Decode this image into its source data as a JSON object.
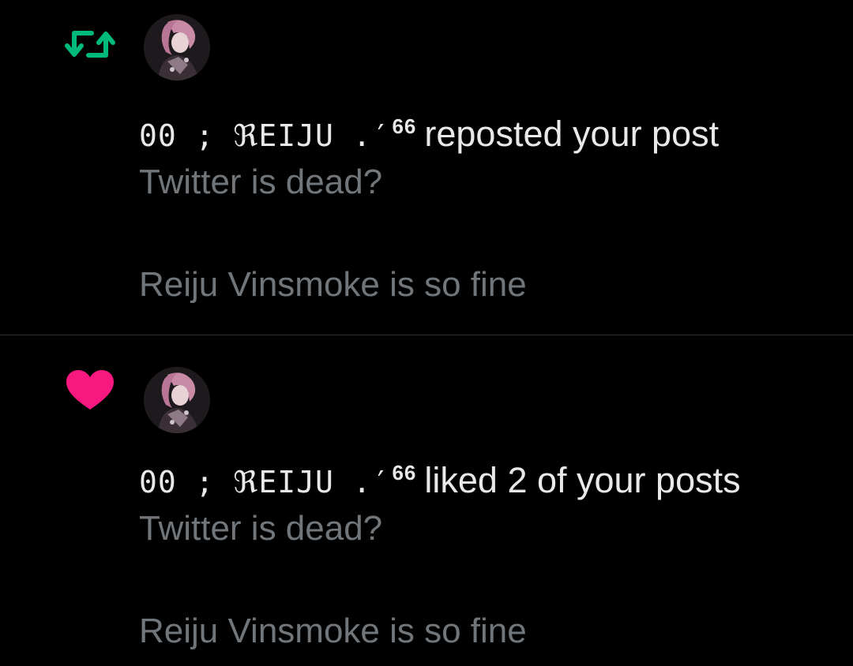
{
  "notifications": [
    {
      "type_icon": "repost-icon",
      "user_handle": "00 ; ℜEIJU .′",
      "handle_superscript": "66",
      "action": "reposted your post",
      "post_lines": [
        "Twitter is dead?",
        "Reiju Vinsmoke is so fine"
      ]
    },
    {
      "type_icon": "heart-icon",
      "user_handle": "00 ; ℜEIJU .′",
      "handle_superscript": "66",
      "action": "liked 2 of your posts",
      "post_lines": [
        "Twitter is dead?",
        "Reiju Vinsmoke is so fine"
      ]
    }
  ],
  "colors": {
    "background": "#000000",
    "repost_green": "#00ba7c",
    "like_pink": "#f91880",
    "primary_text": "#e7e9ea",
    "secondary_text": "#71767b",
    "divider": "#2f3336"
  }
}
